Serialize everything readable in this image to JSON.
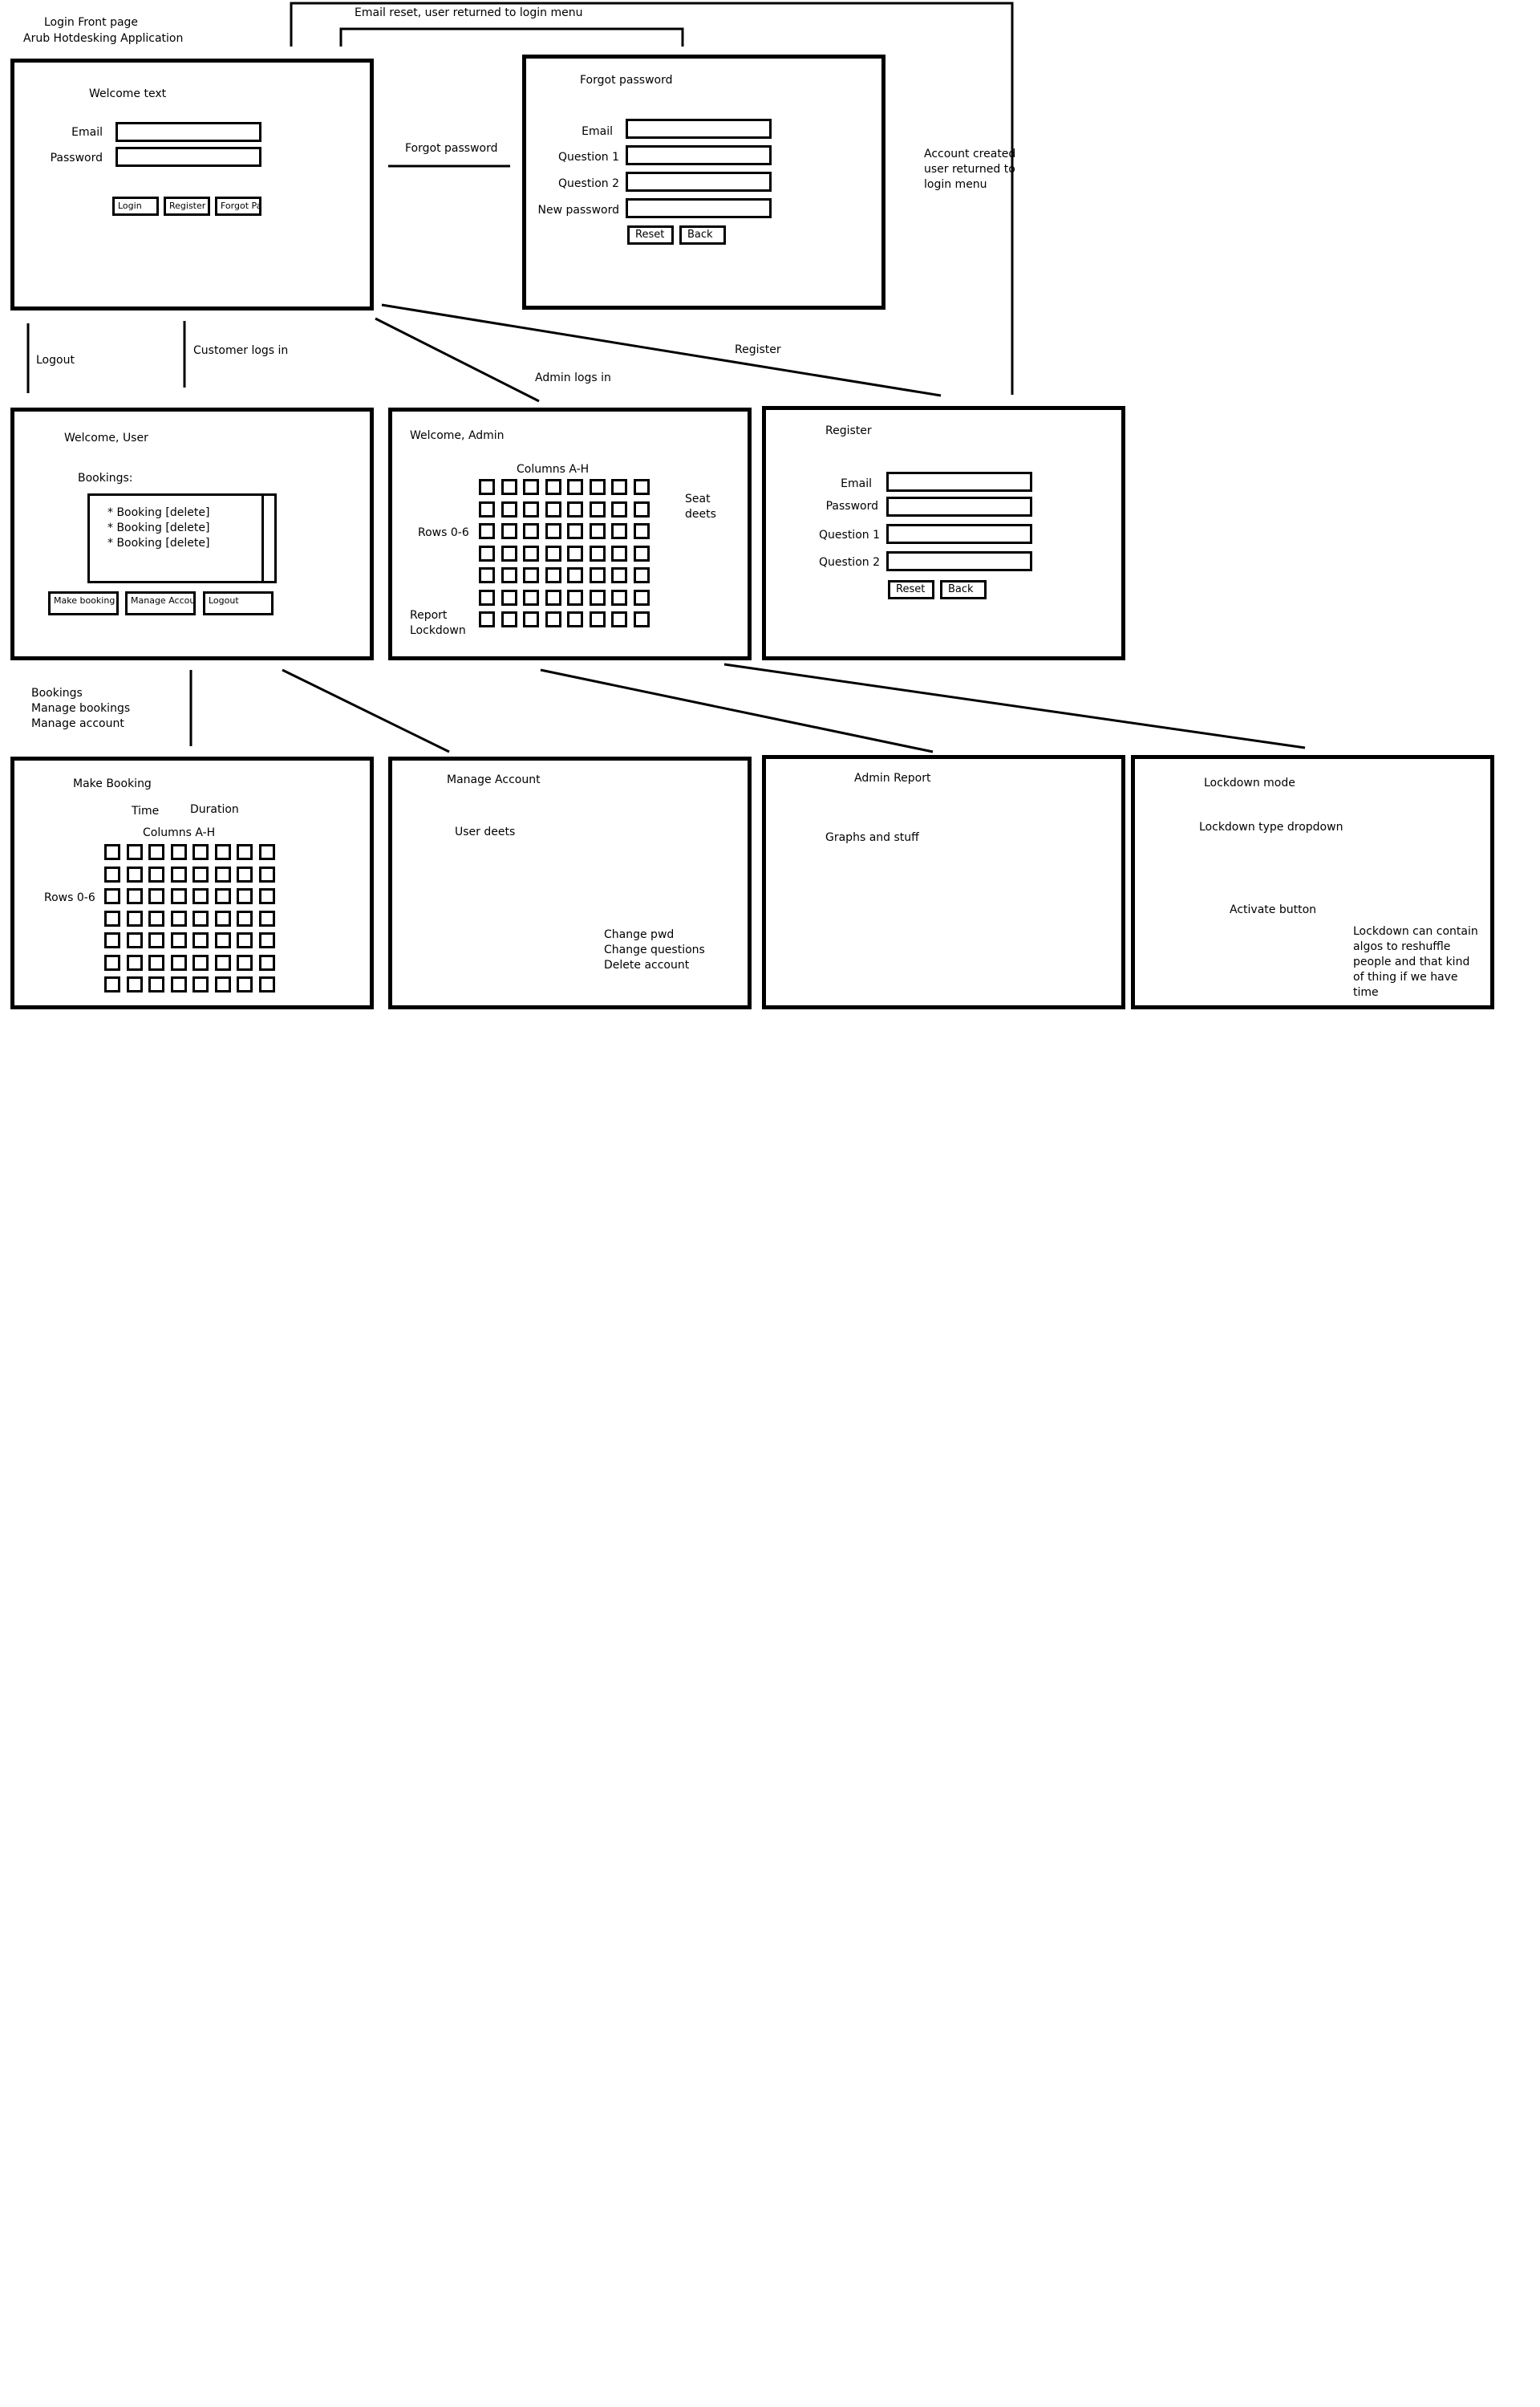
{
  "header": {
    "line1": "Login Front page",
    "line2": "Arub Hotdesking Application"
  },
  "login": {
    "welcome": "Welcome text",
    "email_label": "Email",
    "password_label": "Password",
    "login_btn": "Login",
    "register_btn": "Register",
    "forgot_btn": "Forgot Password"
  },
  "forgot": {
    "title": "Forgot password",
    "email_label": "Email",
    "q1_label": "Question 1",
    "q2_label": "Question 2",
    "newpw_label": "New password",
    "reset_btn": "Reset",
    "back_btn": "Back"
  },
  "user_home": {
    "title": "Welcome, User",
    "bookings_label": "Bookings:",
    "items": [
      "* Booking [delete]",
      "* Booking [delete]",
      "* Booking [delete]"
    ],
    "make_btn": "Make booking",
    "manage_btn": "Manage Account",
    "logout_btn": "Logout"
  },
  "admin_home": {
    "title": "Welcome, Admin",
    "columns": "Columns A-H",
    "rows": "Rows 0-6",
    "seat_line1": "Seat",
    "seat_line2": "deets",
    "report": "Report",
    "lockdown": "Lockdown"
  },
  "register": {
    "title": "Register",
    "email_label": "Email",
    "password_label": "Password",
    "q1_label": "Question 1",
    "q2_label": "Question 2",
    "reset_btn": "Reset",
    "back_btn": "Back"
  },
  "make_booking": {
    "title": "Make Booking",
    "time": "Time",
    "duration": "Duration",
    "columns": "Columns A-H",
    "rows": "Rows 0-6"
  },
  "manage_account": {
    "title": "Manage Account",
    "user_deets": "User deets",
    "change_pwd": "Change pwd",
    "change_questions": "Change questions",
    "delete_account": "Delete account"
  },
  "admin_report": {
    "title": "Admin Report",
    "graphs": "Graphs and stuff"
  },
  "lockdown": {
    "title": "Lockdown mode",
    "dropdown": "Lockdown type dropdown",
    "activate": "Activate button",
    "note": "Lockdown can contain algos to reshuffle people and that kind of thing if we have time"
  },
  "flows": {
    "email_reset": "Email reset, user returned to login menu",
    "forgot_password": "Forgot password",
    "account_created": "Account created user returned to login menu",
    "logout": "Logout",
    "customer_logs_in": "Customer logs in",
    "admin_logs_in": "Admin logs in",
    "register": "Register",
    "bookings_menu_1": "Bookings",
    "bookings_menu_2": "Manage bookings",
    "bookings_menu_3": "Manage account"
  }
}
